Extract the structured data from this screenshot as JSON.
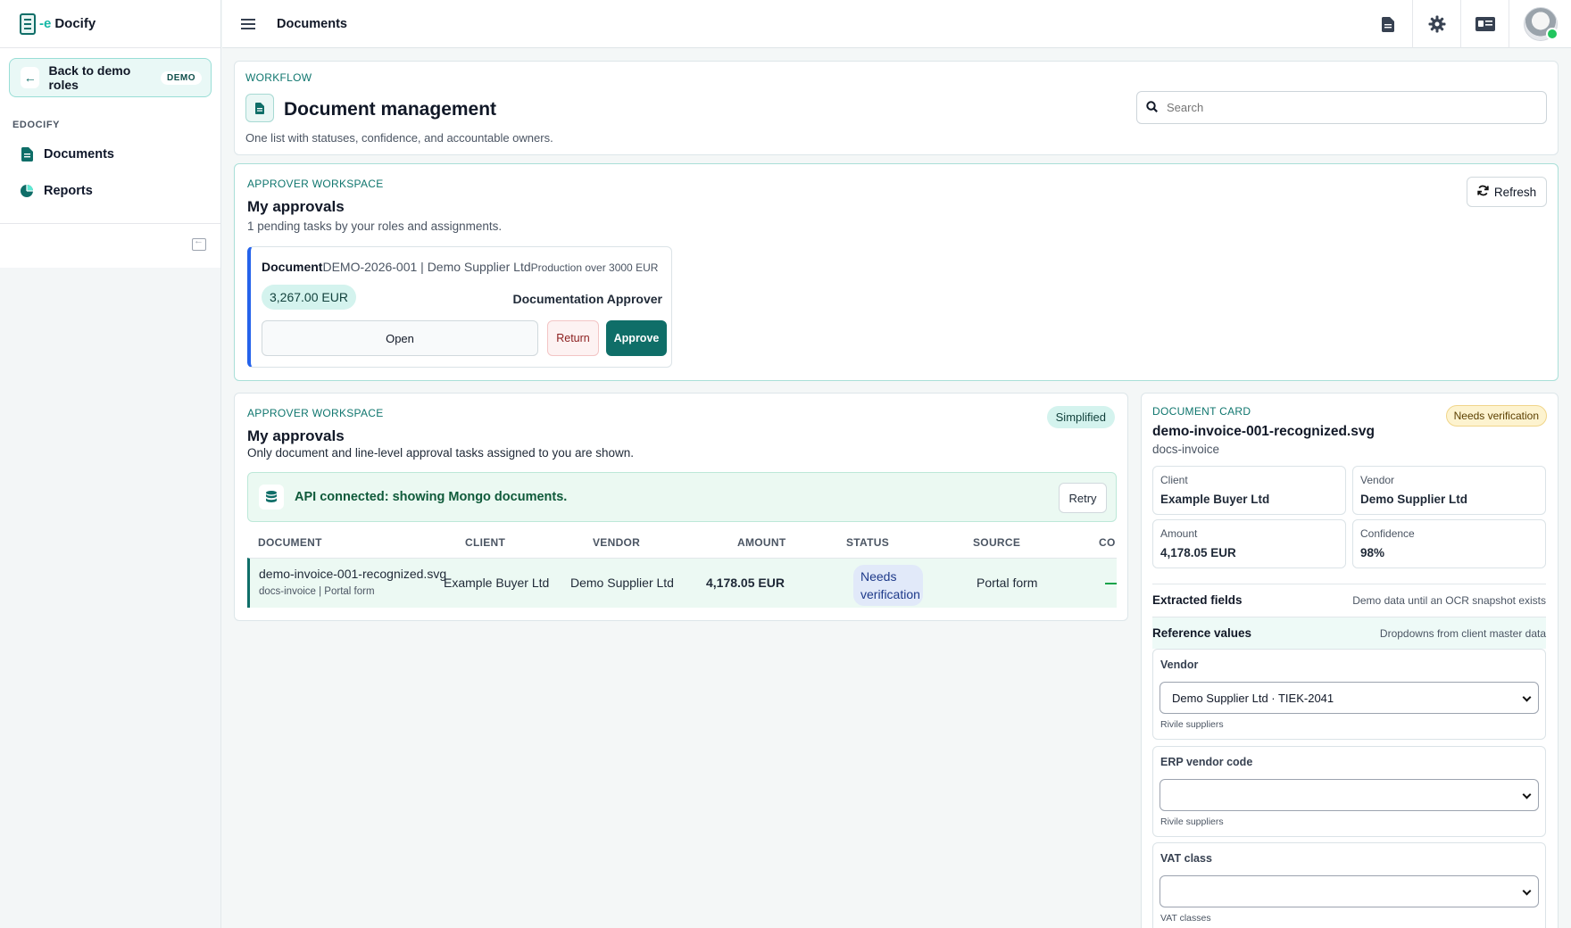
{
  "brand": {
    "prefix": "-e",
    "name": "Docify"
  },
  "sidebar": {
    "back_label": "Back to demo roles",
    "back_badge": "DEMO",
    "section": "EDOCIFY",
    "items": [
      {
        "label": "Documents",
        "icon": "document-icon"
      },
      {
        "label": "Reports",
        "icon": "pie-chart-icon"
      }
    ]
  },
  "topbar": {
    "title": "Documents"
  },
  "workflow": {
    "kicker": "WORKFLOW",
    "title": "Document management",
    "subtitle": "One list with statuses, confidence, and accountable owners.",
    "search_placeholder": "Search"
  },
  "approvals_card": {
    "kicker": "APPROVER WORKSPACE",
    "title": "My approvals",
    "subtitle": "1 pending tasks by your roles and assignments.",
    "refresh_label": "Refresh",
    "task": {
      "type": "Document",
      "doc": "DEMO-2026-001 | Demo Supplier Ltd",
      "note": "Production over 3000 EUR",
      "amount": "3,267.00 EUR",
      "role": "Documentation Approver",
      "open_label": "Open",
      "return_label": "Return",
      "approve_label": "Approve"
    }
  },
  "list_card": {
    "kicker": "APPROVER WORKSPACE",
    "title": "My approvals",
    "subtitle": "Only document and line-level approval tasks assigned to you are shown.",
    "mode_badge": "Simplified",
    "api_text": "API connected: showing Mongo documents.",
    "retry_label": "Retry",
    "columns": [
      "DOCUMENT",
      "CLIENT",
      "VENDOR",
      "AMOUNT",
      "STATUS",
      "SOURCE",
      "CO"
    ],
    "rows": [
      {
        "document": "demo-invoice-001-recognized.svg",
        "doc_meta": "docs-invoice | Portal form",
        "client": "Example Buyer Ltd",
        "vendor": "Demo Supplier Ltd",
        "amount": "4,178.05 EUR",
        "status": "Needs verification",
        "source": "Portal form"
      }
    ]
  },
  "doc_card": {
    "kicker": "DOCUMENT CARD",
    "status": "Needs verification",
    "filename": "demo-invoice-001-recognized.svg",
    "doc_type": "docs-invoice",
    "fields": [
      {
        "label": "Client",
        "value": "Example Buyer Ltd"
      },
      {
        "label": "Vendor",
        "value": "Demo Supplier Ltd"
      },
      {
        "label": "Amount",
        "value": "4,178.05 EUR"
      },
      {
        "label": "Confidence",
        "value": "98%"
      }
    ],
    "extracted": {
      "title": "Extracted fields",
      "note": "Demo data until an OCR snapshot exists"
    },
    "reference": {
      "title": "Reference values",
      "note": "Dropdowns from client master data"
    },
    "ref_fields": [
      {
        "label": "Vendor",
        "value": "Demo Supplier Ltd · TIEK-2041",
        "source": "Rivile suppliers"
      },
      {
        "label": "ERP vendor code",
        "value": "",
        "source": "Rivile suppliers"
      },
      {
        "label": "VAT class",
        "value": "",
        "source": "VAT classes"
      }
    ]
  },
  "colors": {
    "accent": "#0f6e68",
    "accent_light": "#d4f3ee",
    "status_blue": "#2563eb"
  }
}
